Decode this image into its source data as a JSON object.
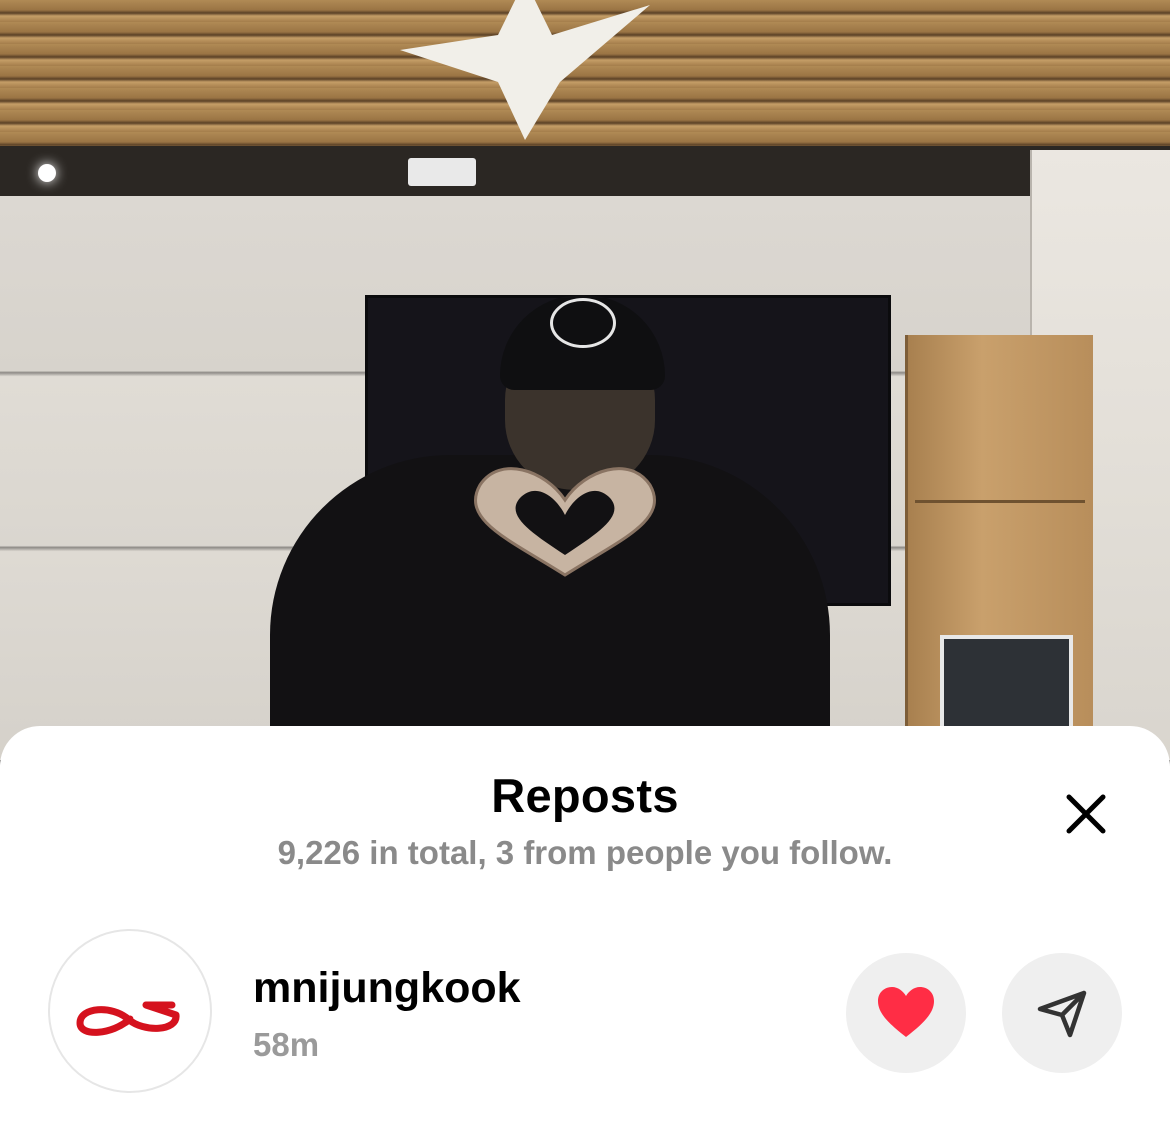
{
  "sheet": {
    "title": "Reposts",
    "subtitle": "9,226 in total, 3 from people you follow."
  },
  "reposts": [
    {
      "username": "mnijungkook",
      "time": "58m",
      "avatar_icon": "red-loop-logo-icon",
      "liked": true
    }
  ],
  "icons": {
    "close": "close-icon",
    "like": "heart-icon",
    "share": "send-icon"
  },
  "colors": {
    "heart": "#ff2d45",
    "avatar_logo": "#d5121e",
    "button_bg": "#efefef",
    "secondary_text": "#8a8a8a"
  }
}
